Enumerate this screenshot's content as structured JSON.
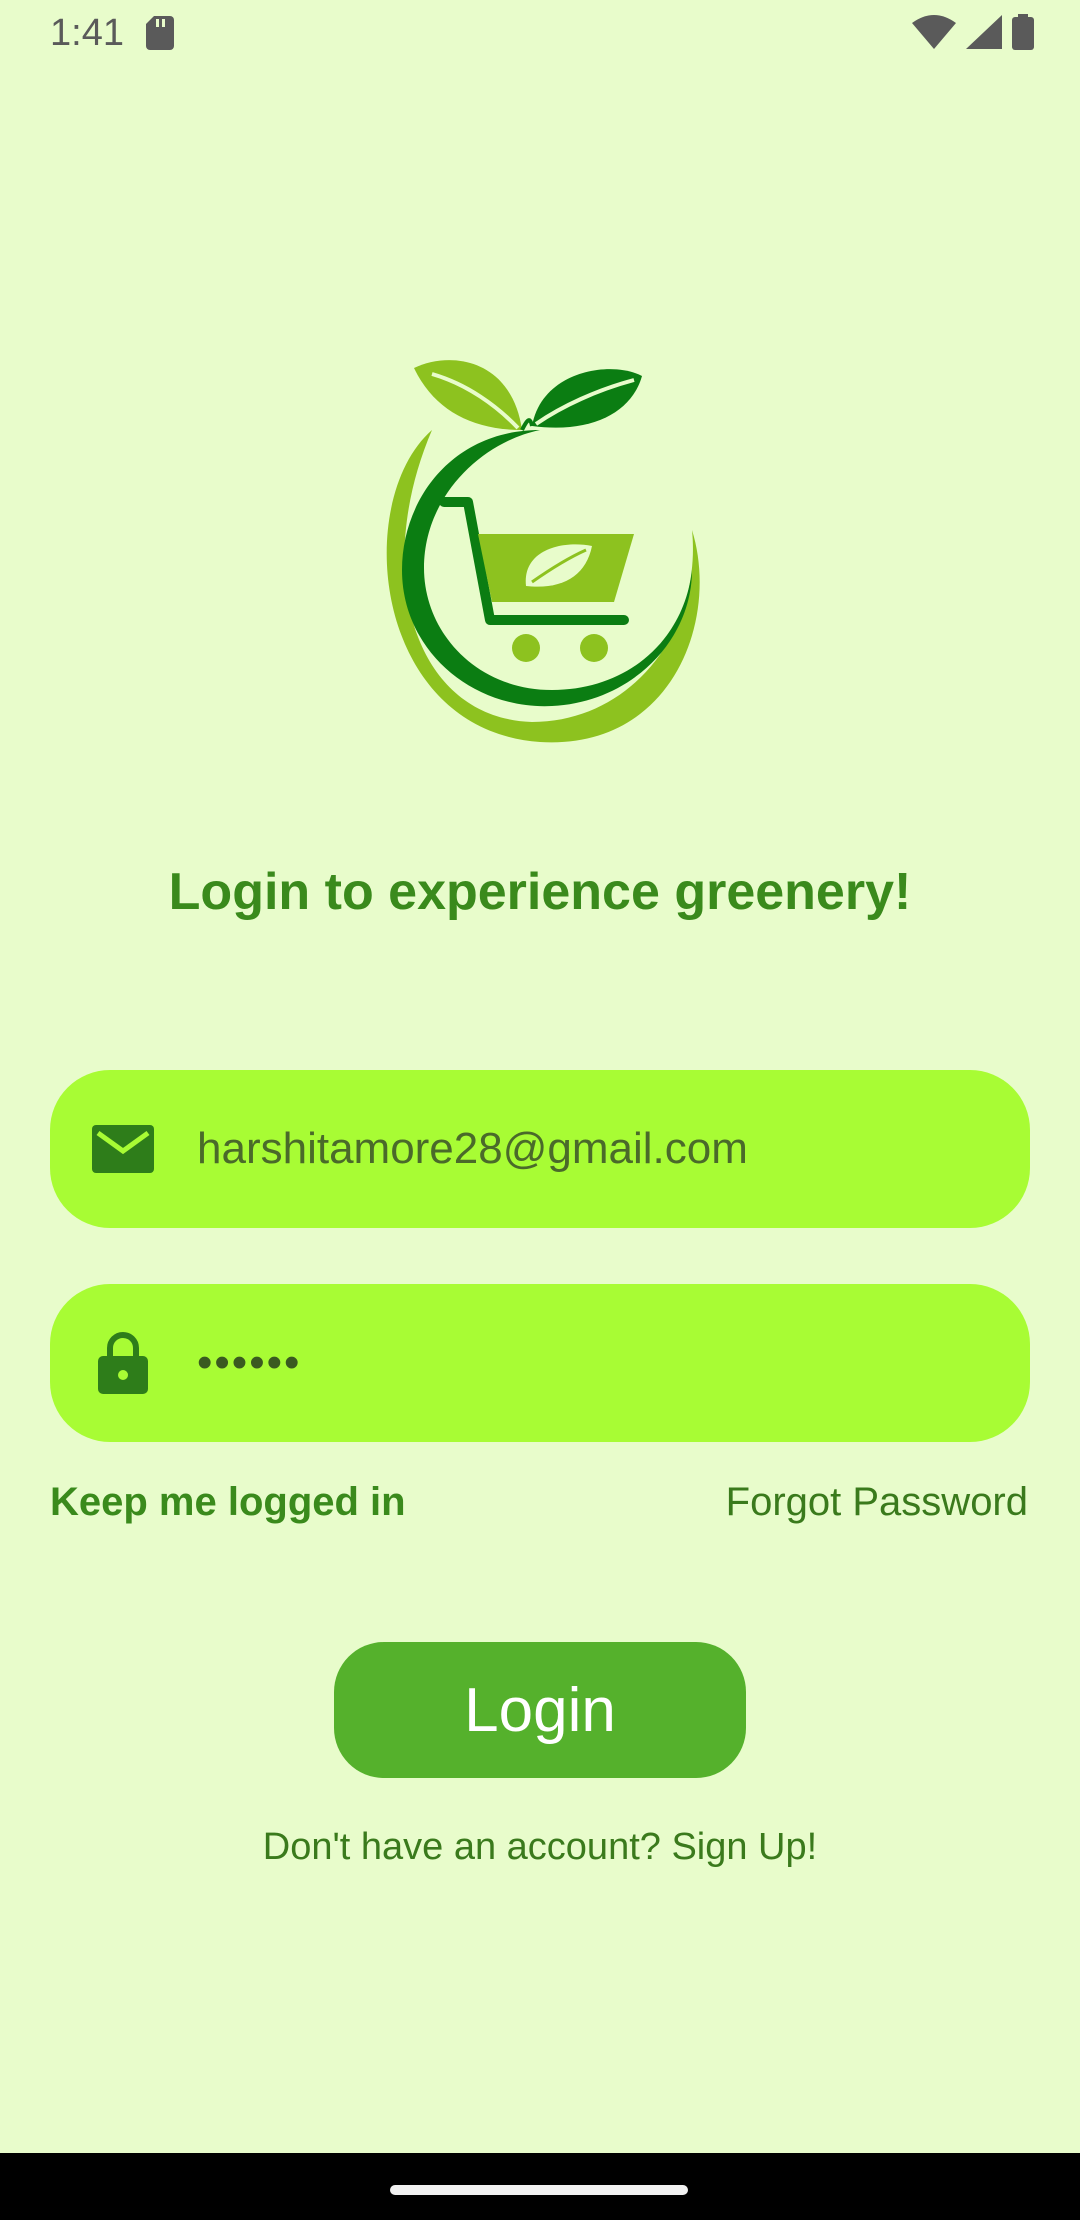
{
  "status_bar": {
    "time": "1:41",
    "icons": [
      "sd-card-icon",
      "wifi-icon",
      "cellular-signal-icon",
      "battery-icon"
    ]
  },
  "logo": {
    "name": "grocery-cart-leaf-logo"
  },
  "headline": "Login to experience greenery!",
  "email_field": {
    "value": "harshitamore28@gmail.com",
    "icon": "mail-icon"
  },
  "password_field": {
    "value": "••••••",
    "icon": "lock-icon"
  },
  "keep_logged_in": "Keep me logged in",
  "forgot_password": "Forgot Password",
  "login_button": "Login",
  "signup_prompt": "Don't have an account? Sign Up!",
  "colors": {
    "background": "#e8fccb",
    "field": "#a8fc34",
    "button": "#55b12c",
    "text_green": "#3a8a1c"
  }
}
